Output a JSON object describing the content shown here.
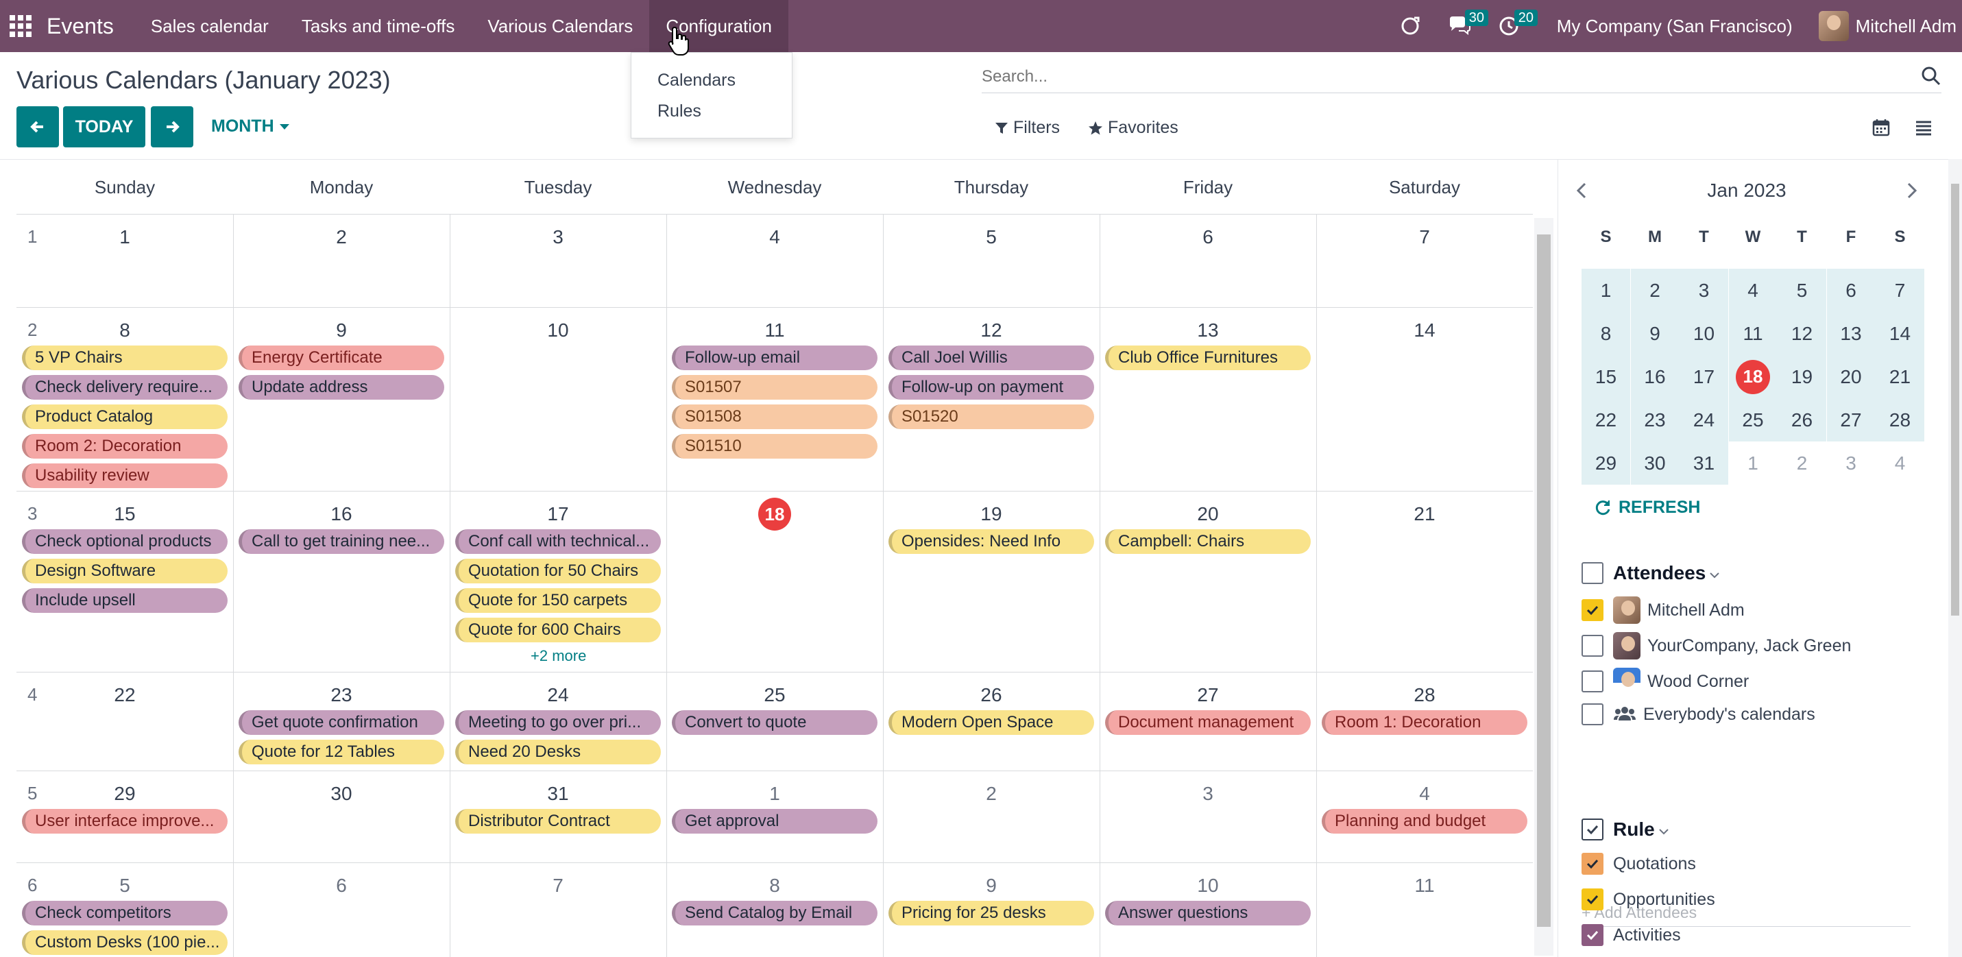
{
  "navbar": {
    "brand": "Events",
    "menu": [
      "Sales calendar",
      "Tasks and time-offs",
      "Various Calendars",
      "Configuration"
    ],
    "chat_badge": "30",
    "activity_badge": "20",
    "company": "My Company (San Francisco)",
    "user": "Mitchell Adm"
  },
  "config_dropdown": [
    "Calendars",
    "Rules"
  ],
  "control": {
    "title": "Various Calendars (January 2023)",
    "today_label": "TODAY",
    "scale_label": "MONTH",
    "search_placeholder": "Search...",
    "filters_label": "Filters",
    "favorites_label": "Favorites"
  },
  "calendar": {
    "weekdays": [
      "Sunday",
      "Monday",
      "Tuesday",
      "Wednesday",
      "Thursday",
      "Friday",
      "Saturday"
    ],
    "weeks": [
      {
        "num": "1",
        "days": [
          "1",
          "2",
          "3",
          "4",
          "5",
          "6",
          "7"
        ]
      },
      {
        "num": "2",
        "days": [
          "8",
          "9",
          "10",
          "11",
          "12",
          "13",
          "14"
        ]
      },
      {
        "num": "3",
        "days": [
          "15",
          "16",
          "17",
          "18",
          "19",
          "20",
          "21"
        ]
      },
      {
        "num": "4",
        "days": [
          "22",
          "23",
          "24",
          "25",
          "26",
          "27",
          "28"
        ]
      },
      {
        "num": "5",
        "days": [
          "29",
          "30",
          "31",
          "1",
          "2",
          "3",
          "4"
        ]
      },
      {
        "num": "6",
        "days": [
          "5",
          "6",
          "7",
          "8",
          "9",
          "10",
          "11"
        ]
      }
    ],
    "today": "18",
    "more_label": "+2 more",
    "events": [
      {
        "week": 1,
        "day": 0,
        "slot": 0,
        "title": "5 VP Chairs",
        "color": "yellow"
      },
      {
        "week": 1,
        "day": 0,
        "slot": 1,
        "title": "Check delivery require...",
        "color": "purple"
      },
      {
        "week": 1,
        "day": 0,
        "slot": 2,
        "title": "Product Catalog",
        "color": "yellow"
      },
      {
        "week": 1,
        "day": 0,
        "slot": 3,
        "title": "Room 2: Decoration",
        "color": "red"
      },
      {
        "week": 1,
        "day": 0,
        "slot": 4,
        "title": "Usability review",
        "color": "red"
      },
      {
        "week": 1,
        "day": 1,
        "slot": 0,
        "title": "Energy Certificate",
        "color": "red"
      },
      {
        "week": 1,
        "day": 1,
        "slot": 1,
        "title": "Update address",
        "color": "purple"
      },
      {
        "week": 1,
        "day": 3,
        "slot": 0,
        "title": "Follow-up email",
        "color": "purple"
      },
      {
        "week": 1,
        "day": 3,
        "slot": 1,
        "title": "S01507",
        "color": "orange"
      },
      {
        "week": 1,
        "day": 3,
        "slot": 2,
        "title": "S01508",
        "color": "orange"
      },
      {
        "week": 1,
        "day": 3,
        "slot": 3,
        "title": "S01510",
        "color": "orange"
      },
      {
        "week": 1,
        "day": 4,
        "slot": 0,
        "title": "Call Joel Willis",
        "color": "purple"
      },
      {
        "week": 1,
        "day": 4,
        "slot": 1,
        "title": "Follow-up on payment",
        "color": "purple"
      },
      {
        "week": 1,
        "day": 4,
        "slot": 2,
        "title": "S01520",
        "color": "orange"
      },
      {
        "week": 1,
        "day": 5,
        "slot": 0,
        "title": "Club Office Furnitures",
        "color": "yellow"
      },
      {
        "week": 2,
        "day": 0,
        "slot": 0,
        "title": "Check optional products",
        "color": "purple"
      },
      {
        "week": 2,
        "day": 0,
        "slot": 1,
        "title": "Design Software",
        "color": "yellow"
      },
      {
        "week": 2,
        "day": 0,
        "slot": 2,
        "title": "Include upsell",
        "color": "purple"
      },
      {
        "week": 2,
        "day": 1,
        "slot": 0,
        "title": "Call to get training nee...",
        "color": "purple"
      },
      {
        "week": 2,
        "day": 2,
        "slot": 0,
        "title": "Conf call with technical...",
        "color": "purple"
      },
      {
        "week": 2,
        "day": 2,
        "slot": 1,
        "title": "Quotation for 50 Chairs",
        "color": "yellow"
      },
      {
        "week": 2,
        "day": 2,
        "slot": 2,
        "title": "Quote for 150 carpets",
        "color": "yellow"
      },
      {
        "week": 2,
        "day": 2,
        "slot": 3,
        "title": "Quote for 600 Chairs",
        "color": "yellow"
      },
      {
        "week": 2,
        "day": 4,
        "slot": 0,
        "title": "Opensides: Need Info",
        "color": "yellow"
      },
      {
        "week": 2,
        "day": 5,
        "slot": 0,
        "title": "Campbell: Chairs",
        "color": "yellow"
      },
      {
        "week": 3,
        "day": 1,
        "slot": 0,
        "title": "Get quote confirmation",
        "color": "purple"
      },
      {
        "week": 3,
        "day": 1,
        "slot": 1,
        "title": "Quote for 12 Tables",
        "color": "yellow"
      },
      {
        "week": 3,
        "day": 2,
        "slot": 0,
        "title": "Meeting to go over pri...",
        "color": "purple"
      },
      {
        "week": 3,
        "day": 2,
        "slot": 1,
        "title": "Need 20 Desks",
        "color": "yellow"
      },
      {
        "week": 3,
        "day": 3,
        "slot": 0,
        "title": "Convert to quote",
        "color": "purple"
      },
      {
        "week": 3,
        "day": 4,
        "slot": 0,
        "title": "Modern Open Space",
        "color": "yellow"
      },
      {
        "week": 3,
        "day": 5,
        "slot": 0,
        "title": "Document management",
        "color": "red"
      },
      {
        "week": 3,
        "day": 6,
        "slot": 0,
        "title": "Room 1: Decoration",
        "color": "red"
      },
      {
        "week": 4,
        "day": 0,
        "slot": 0,
        "title": "User interface improve...",
        "color": "red"
      },
      {
        "week": 4,
        "day": 2,
        "slot": 0,
        "title": "Distributor Contract",
        "color": "yellow"
      },
      {
        "week": 4,
        "day": 3,
        "slot": 0,
        "title": "Get approval",
        "color": "purple"
      },
      {
        "week": 4,
        "day": 6,
        "slot": 0,
        "title": "Planning and budget",
        "color": "red"
      },
      {
        "week": 5,
        "day": 0,
        "slot": 0,
        "title": "Check competitors",
        "color": "purple"
      },
      {
        "week": 5,
        "day": 0,
        "slot": 1,
        "title": "Custom Desks (100 pie...",
        "color": "yellow"
      },
      {
        "week": 5,
        "day": 3,
        "slot": 0,
        "title": "Send Catalog by Email",
        "color": "purple"
      },
      {
        "week": 5,
        "day": 4,
        "slot": 0,
        "title": "Pricing for 25 desks",
        "color": "yellow"
      },
      {
        "week": 5,
        "day": 5,
        "slot": 0,
        "title": "Answer questions",
        "color": "purple"
      }
    ]
  },
  "mini_calendar": {
    "title": "Jan 2023",
    "weekdays": [
      "S",
      "M",
      "T",
      "W",
      "T",
      "F",
      "S"
    ],
    "rows": [
      [
        "1",
        "2",
        "3",
        "4",
        "5",
        "6",
        "7"
      ],
      [
        "8",
        "9",
        "10",
        "11",
        "12",
        "13",
        "14"
      ],
      [
        "15",
        "16",
        "17",
        "18",
        "19",
        "20",
        "21"
      ],
      [
        "22",
        "23",
        "24",
        "25",
        "26",
        "27",
        "28"
      ],
      [
        "29",
        "30",
        "31",
        "1",
        "2",
        "3",
        "4"
      ]
    ],
    "today": "18",
    "refresh_label": "REFRESH"
  },
  "attendees": {
    "title": "Attendees",
    "items": [
      {
        "label": "Mitchell Adm",
        "checked": true
      },
      {
        "label": "YourCompany, Jack Green",
        "checked": false
      },
      {
        "label": "Wood Corner",
        "checked": false
      },
      {
        "label": "Everybody's calendars",
        "checked": false
      }
    ],
    "add_placeholder": "+ Add Attendees"
  },
  "rules": {
    "title": "Rule",
    "items": [
      {
        "label": "Quotations",
        "checked": true,
        "color": "#f0a35e"
      },
      {
        "label": "Opportunities",
        "checked": true,
        "color": "#f5c518"
      },
      {
        "label": "Activities",
        "checked": true,
        "color": "#8b5a80"
      }
    ]
  },
  "colors": {
    "navbar": "#714B67",
    "accent": "#017e84",
    "today": "#ea3e3e",
    "ev_yellow": "#f9e38b",
    "ev_purple": "#c59fbd",
    "ev_red": "#f4a7a5",
    "ev_orange": "#f8c9a4"
  }
}
